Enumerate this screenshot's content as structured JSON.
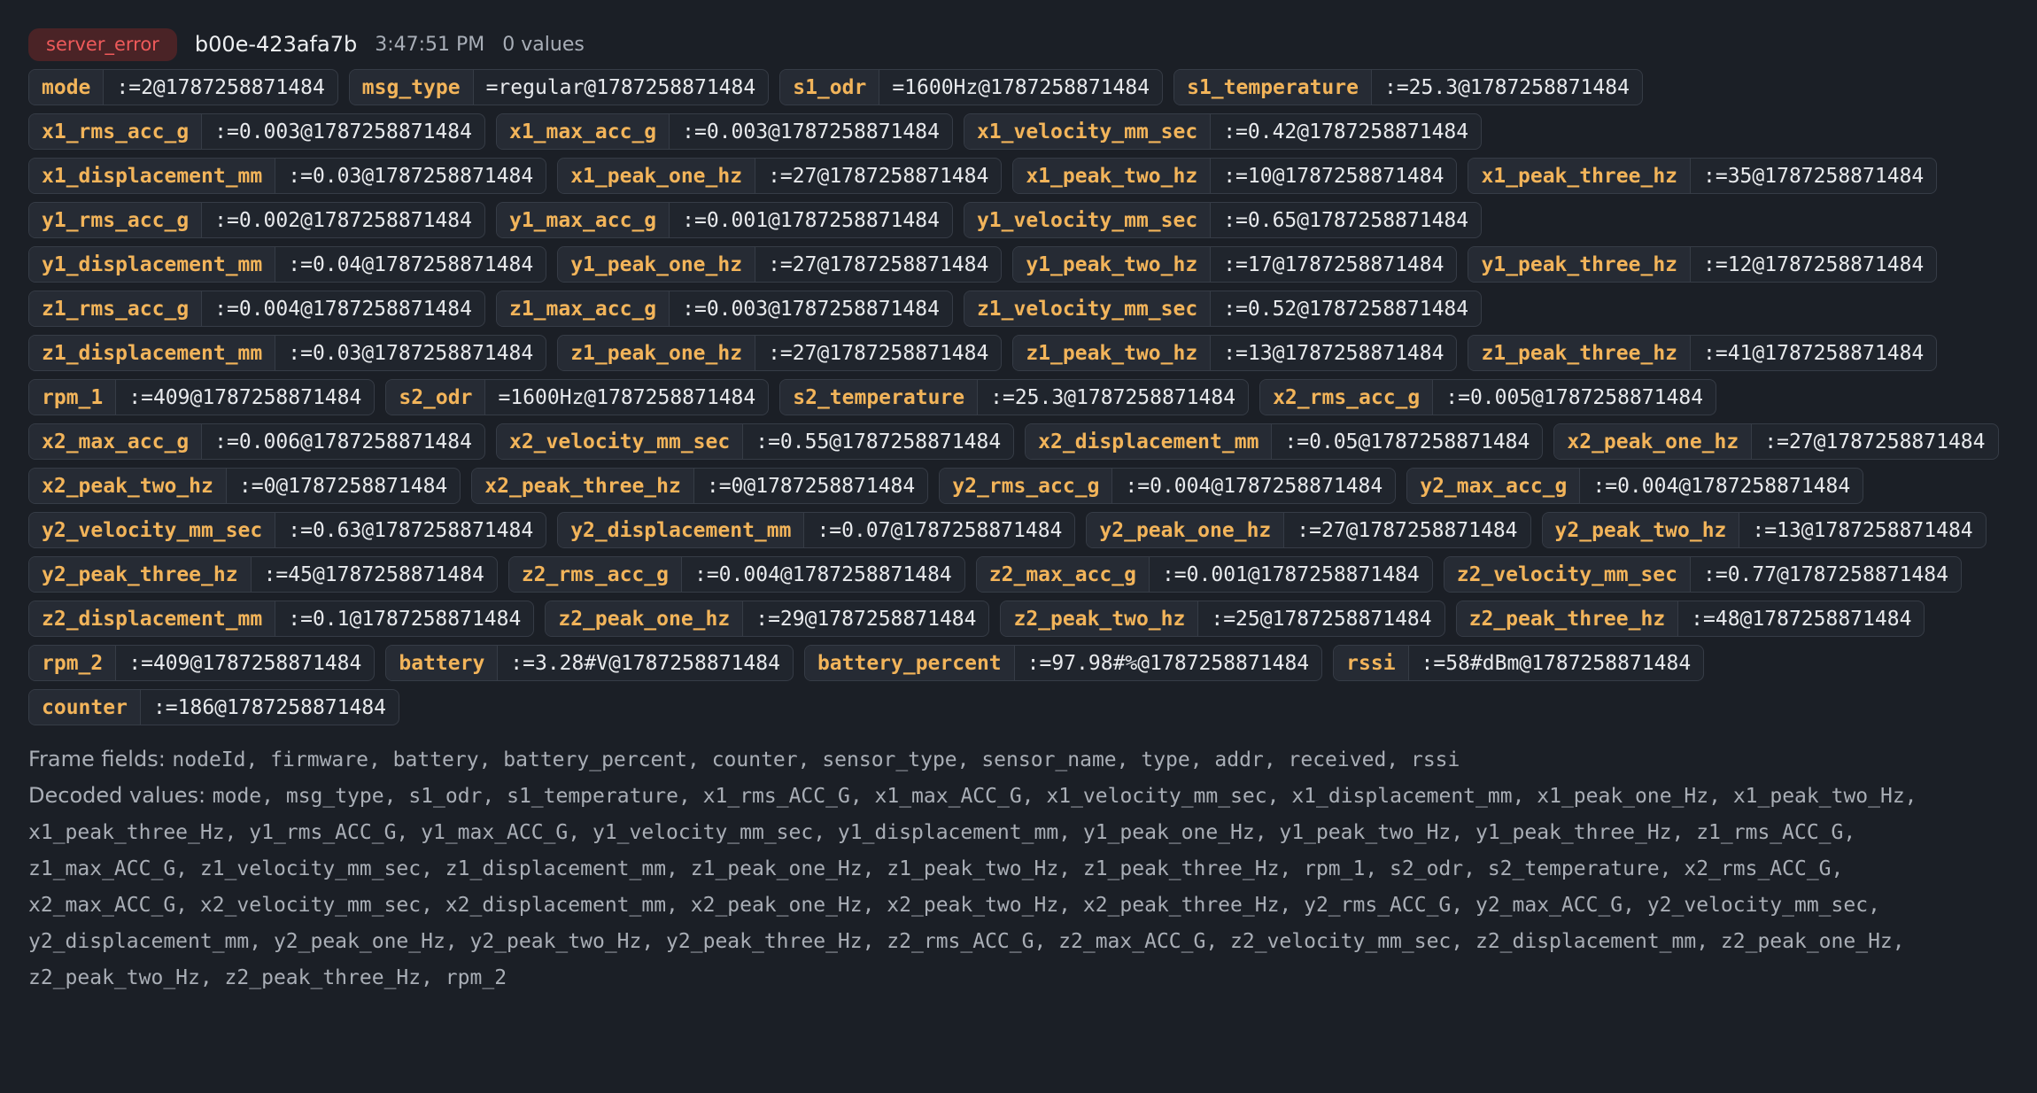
{
  "header": {
    "status": "server_error",
    "id": "b00e-423afa7b",
    "time": "3:47:51 PM",
    "count": "0 values"
  },
  "fields": [
    {
      "key": "mode",
      "value": ":=2@1787258871484"
    },
    {
      "key": "msg_type",
      "value": "=regular@1787258871484"
    },
    {
      "key": "s1_odr",
      "value": "=1600Hz@1787258871484"
    },
    {
      "key": "s1_temperature",
      "value": ":=25.3@1787258871484"
    },
    {
      "key": "x1_rms_acc_g",
      "value": ":=0.003@1787258871484"
    },
    {
      "key": "x1_max_acc_g",
      "value": ":=0.003@1787258871484"
    },
    {
      "key": "x1_velocity_mm_sec",
      "value": ":=0.42@1787258871484"
    },
    {
      "key": "x1_displacement_mm",
      "value": ":=0.03@1787258871484"
    },
    {
      "key": "x1_peak_one_hz",
      "value": ":=27@1787258871484"
    },
    {
      "key": "x1_peak_two_hz",
      "value": ":=10@1787258871484"
    },
    {
      "key": "x1_peak_three_hz",
      "value": ":=35@1787258871484"
    },
    {
      "key": "y1_rms_acc_g",
      "value": ":=0.002@1787258871484"
    },
    {
      "key": "y1_max_acc_g",
      "value": ":=0.001@1787258871484"
    },
    {
      "key": "y1_velocity_mm_sec",
      "value": ":=0.65@1787258871484"
    },
    {
      "key": "y1_displacement_mm",
      "value": ":=0.04@1787258871484"
    },
    {
      "key": "y1_peak_one_hz",
      "value": ":=27@1787258871484"
    },
    {
      "key": "y1_peak_two_hz",
      "value": ":=17@1787258871484"
    },
    {
      "key": "y1_peak_three_hz",
      "value": ":=12@1787258871484"
    },
    {
      "key": "z1_rms_acc_g",
      "value": ":=0.004@1787258871484"
    },
    {
      "key": "z1_max_acc_g",
      "value": ":=0.003@1787258871484"
    },
    {
      "key": "z1_velocity_mm_sec",
      "value": ":=0.52@1787258871484"
    },
    {
      "key": "z1_displacement_mm",
      "value": ":=0.03@1787258871484"
    },
    {
      "key": "z1_peak_one_hz",
      "value": ":=27@1787258871484"
    },
    {
      "key": "z1_peak_two_hz",
      "value": ":=13@1787258871484"
    },
    {
      "key": "z1_peak_three_hz",
      "value": ":=41@1787258871484"
    },
    {
      "key": "rpm_1",
      "value": ":=409@1787258871484"
    },
    {
      "key": "s2_odr",
      "value": "=1600Hz@1787258871484"
    },
    {
      "key": "s2_temperature",
      "value": ":=25.3@1787258871484"
    },
    {
      "key": "x2_rms_acc_g",
      "value": ":=0.005@1787258871484"
    },
    {
      "key": "x2_max_acc_g",
      "value": ":=0.006@1787258871484"
    },
    {
      "key": "x2_velocity_mm_sec",
      "value": ":=0.55@1787258871484"
    },
    {
      "key": "x2_displacement_mm",
      "value": ":=0.05@1787258871484"
    },
    {
      "key": "x2_peak_one_hz",
      "value": ":=27@1787258871484"
    },
    {
      "key": "x2_peak_two_hz",
      "value": ":=0@1787258871484"
    },
    {
      "key": "x2_peak_three_hz",
      "value": ":=0@1787258871484"
    },
    {
      "key": "y2_rms_acc_g",
      "value": ":=0.004@1787258871484"
    },
    {
      "key": "y2_max_acc_g",
      "value": ":=0.004@1787258871484"
    },
    {
      "key": "y2_velocity_mm_sec",
      "value": ":=0.63@1787258871484"
    },
    {
      "key": "y2_displacement_mm",
      "value": ":=0.07@1787258871484"
    },
    {
      "key": "y2_peak_one_hz",
      "value": ":=27@1787258871484"
    },
    {
      "key": "y2_peak_two_hz",
      "value": ":=13@1787258871484"
    },
    {
      "key": "y2_peak_three_hz",
      "value": ":=45@1787258871484"
    },
    {
      "key": "z2_rms_acc_g",
      "value": ":=0.004@1787258871484"
    },
    {
      "key": "z2_max_acc_g",
      "value": ":=0.001@1787258871484"
    },
    {
      "key": "z2_velocity_mm_sec",
      "value": ":=0.77@1787258871484"
    },
    {
      "key": "z2_displacement_mm",
      "value": ":=0.1@1787258871484"
    },
    {
      "key": "z2_peak_one_hz",
      "value": ":=29@1787258871484"
    },
    {
      "key": "z2_peak_two_hz",
      "value": ":=25@1787258871484"
    },
    {
      "key": "z2_peak_three_hz",
      "value": ":=48@1787258871484"
    },
    {
      "key": "rpm_2",
      "value": ":=409@1787258871484"
    },
    {
      "key": "battery",
      "value": ":=3.28#V@1787258871484"
    },
    {
      "key": "battery_percent",
      "value": ":=97.98#%@1787258871484"
    },
    {
      "key": "rssi",
      "value": ":=58#dBm@1787258871484"
    },
    {
      "key": "counter",
      "value": ":=186@1787258871484"
    }
  ],
  "frame_fields": {
    "label": "Frame fields: ",
    "list": "nodeId, firmware, battery, battery_percent, counter, sensor_type, sensor_name, type, addr, received, rssi"
  },
  "decoded_values": {
    "label": "Decoded values: ",
    "list": "mode, msg_type, s1_odr, s1_temperature, x1_rms_ACC_G, x1_max_ACC_G, x1_velocity_mm_sec, x1_displacement_mm, x1_peak_one_Hz, x1_peak_two_Hz, x1_peak_three_Hz, y1_rms_ACC_G, y1_max_ACC_G, y1_velocity_mm_sec, y1_displacement_mm, y1_peak_one_Hz, y1_peak_two_Hz, y1_peak_three_Hz, z1_rms_ACC_G, z1_max_ACC_G, z1_velocity_mm_sec, z1_displacement_mm, z1_peak_one_Hz, z1_peak_two_Hz, z1_peak_three_Hz, rpm_1, s2_odr, s2_temperature, x2_rms_ACC_G, x2_max_ACC_G, x2_velocity_mm_sec, x2_displacement_mm, x2_peak_one_Hz, x2_peak_two_Hz, x2_peak_three_Hz, y2_rms_ACC_G, y2_max_ACC_G, y2_velocity_mm_sec, y2_displacement_mm, y2_peak_one_Hz, y2_peak_two_Hz, y2_peak_three_Hz, z2_rms_ACC_G, z2_max_ACC_G, z2_velocity_mm_sec, z2_displacement_mm, z2_peak_one_Hz, z2_peak_two_Hz, z2_peak_three_Hz, rpm_2"
  },
  "colors": {
    "background": "#1b1f26",
    "key_text": "#f2b45a",
    "error_badge_bg": "#4a2326",
    "error_badge_text": "#ef5a5a"
  }
}
